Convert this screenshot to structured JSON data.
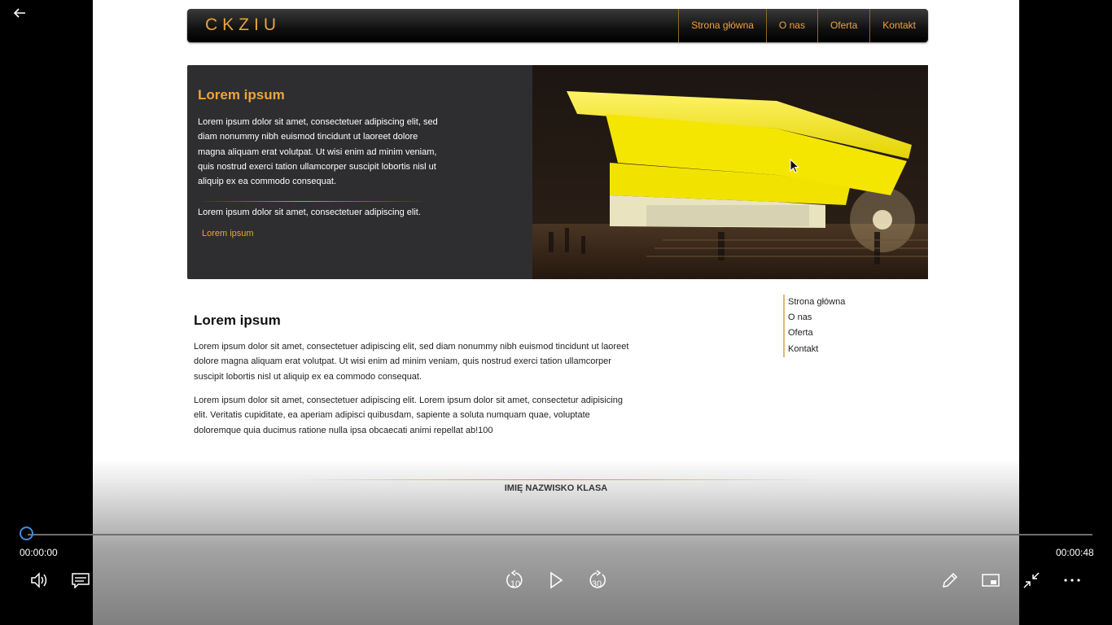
{
  "site": {
    "logo": "CKZIU",
    "nav": [
      "Strona główna",
      "O nas",
      "Oferta",
      "Kontakt"
    ],
    "hero": {
      "title": "Lorem ipsum",
      "text": "Lorem ipsum dolor sit amet, consectetuer adipiscing elit, sed diam nonummy nibh euismod tincidunt ut laoreet dolore magna aliquam erat volutpat. Ut wisi enim ad minim veniam, quis nostrud exerci tation ullamcorper suscipit lobortis nisl ut aliquip ex ea commodo consequat.",
      "text2": "Lorem ipsum dolor sit amet, consectetuer adipiscing elit.",
      "link": "Lorem ipsum"
    },
    "content": {
      "title": "Lorem ipsum",
      "p1": "Lorem ipsum dolor sit amet, consectetuer adipiscing elit, sed diam nonummy nibh euismod tincidunt ut laoreet dolore magna aliquam erat volutpat. Ut wisi enim ad minim veniam, quis nostrud exerci tation ullamcorper suscipit lobortis nisl ut aliquip ex ea commodo consequat.",
      "p2": "Lorem ipsum dolor sit amet, consectetuer adipiscing elit. Lorem ipsum dolor sit amet, consectetur adipisicing elit. Veritatis cupiditate, ea aperiam adipisci quibusdam, sapiente a soluta numquam quae, voluptate doloremque quia ducimus ratione nulla ipsa obcaecati animi repellat ab!100"
    },
    "side_menu": [
      "Strona główna",
      "O nas",
      "Oferta",
      "Kontakt"
    ],
    "footer": "IMIĘ NAZWISKO KLASA"
  },
  "player": {
    "current_time": "00:00:00",
    "total_time": "00:00:48",
    "progress": 0,
    "controls": {
      "back": "back-arrow-icon",
      "volume": "volume-icon",
      "subtitles": "subtitles-icon",
      "rewind_seconds": "10",
      "play": "play-icon",
      "forward_seconds": "30",
      "edit": "pencil-icon",
      "mini_view": "mini-view-icon",
      "exit_fullscreen": "exit-fullscreen-icon",
      "more": "more-options-icon"
    }
  },
  "colors": {
    "accent": "#f0a33a",
    "seek_handle": "#3b8de0",
    "hero_background": "#2e2e30"
  }
}
